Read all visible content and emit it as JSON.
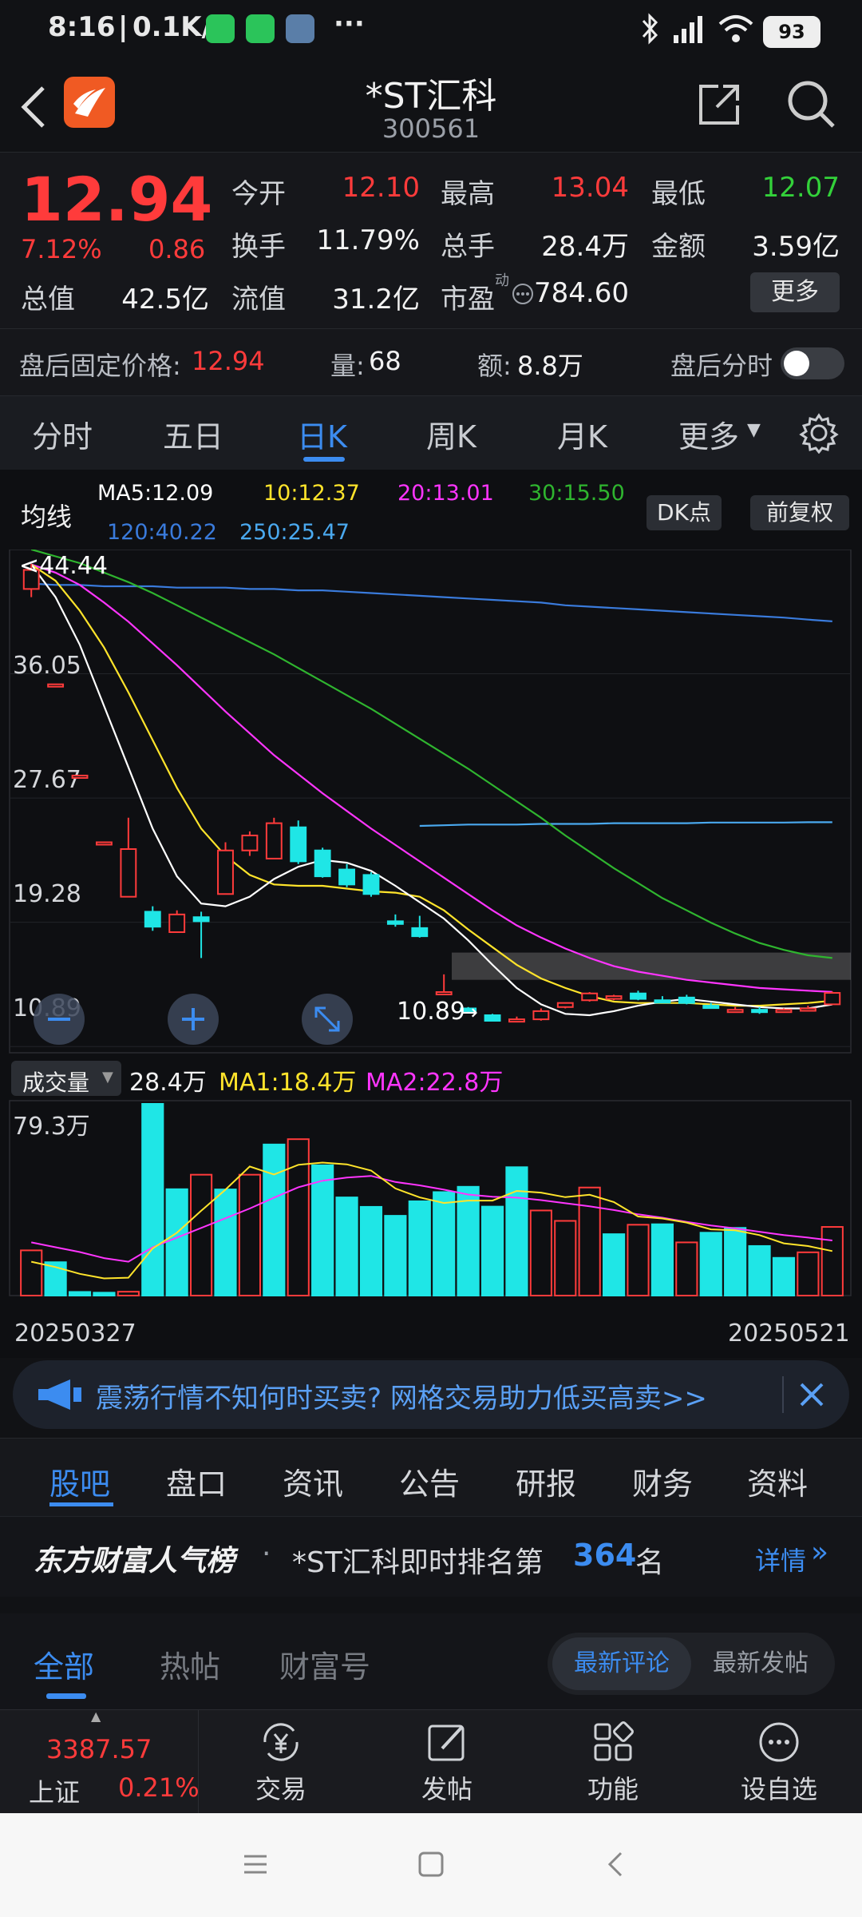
{
  "status_bar": {
    "time": "8:16",
    "net_speed": "0.1K/s",
    "battery": "93",
    "more": "···"
  },
  "header": {
    "title": "*ST汇科",
    "code": "300561"
  },
  "quote": {
    "price": "12.94",
    "change_pct": "7.12%",
    "change_amt": "0.86",
    "open_label": "今开",
    "open_val": "12.10",
    "high_label": "最高",
    "high_val": "13.04",
    "low_label": "最低",
    "low_val": "12.07",
    "turnover_label": "换手",
    "turnover_val": "11.79%",
    "volume_label": "总手",
    "volume_val": "28.4万",
    "amount_label": "金额",
    "amount_val": "3.59亿",
    "mktcap_label": "总值",
    "mktcap_val": "42.5亿",
    "float_label": "流值",
    "float_val": "31.2亿",
    "pe_label": "市盈",
    "pe_sup": "动",
    "pe_val": "784.60",
    "more_button": "更多",
    "after_label": "盘后固定价格:",
    "after_price": "12.94",
    "after_vol_label": "量:",
    "after_vol": "68",
    "after_amt_label": "额:",
    "after_amt": "8.8万",
    "after_toggle_label": "盘后分时"
  },
  "kline_tabs": [
    "分时",
    "五日",
    "日K",
    "周K",
    "月K",
    "更多"
  ],
  "kline_active": "日K",
  "ma_legend": {
    "title": "均线",
    "ma5": "MA5:12.09",
    "ma10": "10:12.37",
    "ma20": "20:13.01",
    "ma30": "30:15.50",
    "ma120": "120:40.22",
    "ma250": "250:25.47",
    "dk_button": "DK点",
    "adjust_button": "前复权"
  },
  "colors": {
    "up": "#ff3b3b",
    "down": "#1fe6e6",
    "ma5": "#ffffff",
    "ma10": "#ffe42b",
    "ma20": "#ff35ff",
    "ma30": "#2fb52f",
    "ma120": "#3a7bdc",
    "ma250": "#4aa9ef",
    "accent": "#3c8cf0"
  },
  "chart_data": [
    {
      "type": "candlestick",
      "y_ticks": [
        "36.05",
        "27.67",
        "19.28",
        "10.89"
      ],
      "max_label": "<44.44",
      "min_label": "10.89",
      "ylim": [
        10.89,
        44.44
      ],
      "candles": [
        {
          "o": 42.6,
          "c": 44.0,
          "h": 44.44,
          "l": 42.0
        },
        {
          "o": 35.6,
          "c": 35.6,
          "h": 35.6,
          "l": 35.6
        },
        {
          "o": 28.9,
          "c": 28.9,
          "h": 28.9,
          "l": 28.9
        },
        {
          "o": 24.0,
          "c": 24.0,
          "h": 24.0,
          "l": 24.0
        },
        {
          "o": 20.0,
          "c": 23.5,
          "h": 25.8,
          "l": 20.0
        },
        {
          "o": 18.9,
          "c": 17.8,
          "h": 19.3,
          "l": 17.5
        },
        {
          "o": 17.4,
          "c": 18.7,
          "h": 19.0,
          "l": 17.4
        },
        {
          "o": 18.5,
          "c": 18.2,
          "h": 18.9,
          "l": 15.5
        },
        {
          "o": 20.2,
          "c": 23.4,
          "h": 24.0,
          "l": 20.2
        },
        {
          "o": 23.4,
          "c": 24.5,
          "h": 24.8,
          "l": 23.0
        },
        {
          "o": 22.8,
          "c": 25.4,
          "h": 25.8,
          "l": 22.8
        },
        {
          "o": 25.1,
          "c": 22.6,
          "h": 25.6,
          "l": 22.4
        },
        {
          "o": 23.4,
          "c": 21.5,
          "h": 23.6,
          "l": 21.4
        },
        {
          "o": 22.0,
          "c": 20.9,
          "h": 22.4,
          "l": 20.7
        },
        {
          "o": 21.6,
          "c": 20.2,
          "h": 21.8,
          "l": 20.0
        },
        {
          "o": 18.2,
          "c": 18.0,
          "h": 18.7,
          "l": 17.8
        },
        {
          "o": 17.7,
          "c": 17.1,
          "h": 18.6,
          "l": 17.0
        },
        {
          "o": 13.0,
          "c": 13.0,
          "h": 14.3,
          "l": 13.0
        },
        {
          "o": 11.8,
          "c": 11.6,
          "h": 11.9,
          "l": 11.5
        },
        {
          "o": 11.3,
          "c": 10.89,
          "h": 11.4,
          "l": 10.89
        },
        {
          "o": 10.95,
          "c": 11.0,
          "h": 11.2,
          "l": 10.9
        },
        {
          "o": 11.0,
          "c": 11.6,
          "h": 11.8,
          "l": 10.9
        },
        {
          "o": 11.9,
          "c": 12.2,
          "h": 12.2,
          "l": 11.8
        },
        {
          "o": 12.4,
          "c": 12.9,
          "h": 13.0,
          "l": 12.3
        },
        {
          "o": 12.5,
          "c": 12.7,
          "h": 12.8,
          "l": 12.4
        },
        {
          "o": 12.9,
          "c": 12.5,
          "h": 13.1,
          "l": 12.4
        },
        {
          "o": 12.4,
          "c": 12.3,
          "h": 12.7,
          "l": 12.2
        },
        {
          "o": 12.6,
          "c": 12.2,
          "h": 12.8,
          "l": 12.1
        },
        {
          "o": 12.0,
          "c": 11.9,
          "h": 12.2,
          "l": 11.8
        },
        {
          "o": 11.6,
          "c": 11.7,
          "h": 11.9,
          "l": 11.5
        },
        {
          "o": 11.7,
          "c": 11.6,
          "h": 11.9,
          "l": 11.4
        },
        {
          "o": 11.6,
          "c": 11.7,
          "h": 11.8,
          "l": 11.5
        },
        {
          "o": 11.7,
          "c": 11.8,
          "h": 12.0,
          "l": 11.6
        },
        {
          "o": 12.1,
          "c": 12.94,
          "h": 13.04,
          "l": 12.07
        }
      ],
      "ma5": [
        44.4,
        42.0,
        38.5,
        34.0,
        29.5,
        25.0,
        21.5,
        19.5,
        19.3,
        20.0,
        21.3,
        22.2,
        22.7,
        22.5,
        21.9,
        20.8,
        19.6,
        18.4,
        16.8,
        15.0,
        13.3,
        12.1,
        11.4,
        11.3,
        11.6,
        12.0,
        12.3,
        12.5,
        12.3,
        12.1,
        11.9,
        11.8,
        11.8,
        12.09
      ],
      "ma10": [
        44.4,
        43.2,
        41.0,
        38.3,
        35.0,
        31.5,
        28.0,
        25.0,
        23.0,
        21.6,
        20.9,
        20.8,
        20.8,
        20.6,
        20.4,
        20.3,
        20.0,
        19.0,
        17.6,
        16.3,
        15.0,
        14.0,
        13.3,
        12.7,
        12.3,
        12.2,
        12.2,
        12.2,
        12.1,
        12.0,
        12.0,
        12.1,
        12.2,
        12.37
      ],
      "ma20": [
        44.4,
        43.8,
        42.9,
        41.6,
        40.2,
        38.6,
        37.0,
        35.3,
        33.6,
        32.0,
        30.4,
        29.0,
        27.6,
        26.3,
        25.0,
        23.8,
        22.6,
        21.4,
        20.2,
        19.0,
        17.9,
        17.0,
        16.2,
        15.5,
        14.9,
        14.5,
        14.2,
        13.9,
        13.7,
        13.5,
        13.3,
        13.2,
        13.1,
        13.01
      ],
      "ma30": [
        45.5,
        45.0,
        44.5,
        43.8,
        43.1,
        42.3,
        41.4,
        40.5,
        39.6,
        38.7,
        37.8,
        36.8,
        35.8,
        34.8,
        33.8,
        32.7,
        31.6,
        30.5,
        29.4,
        28.2,
        27.0,
        25.8,
        24.5,
        23.3,
        22.1,
        21.0,
        19.9,
        19.0,
        18.1,
        17.3,
        16.6,
        16.1,
        15.7,
        15.5
      ],
      "ma120": [
        43.0,
        42.9,
        42.9,
        42.8,
        42.8,
        42.8,
        42.7,
        42.7,
        42.7,
        42.6,
        42.6,
        42.5,
        42.5,
        42.4,
        42.3,
        42.2,
        42.1,
        42.0,
        41.9,
        41.8,
        41.7,
        41.6,
        41.4,
        41.3,
        41.2,
        41.1,
        41.0,
        40.9,
        40.8,
        40.7,
        40.6,
        40.5,
        40.35,
        40.22
      ],
      "ma250_segment": {
        "from_index": 16,
        "values": [
          25.2,
          25.25,
          25.3,
          25.3,
          25.3,
          25.35,
          25.35,
          25.35,
          25.4,
          25.4,
          25.4,
          25.4,
          25.45,
          25.45,
          25.45,
          25.45,
          25.47,
          25.47
        ]
      }
    },
    {
      "type": "bar",
      "legend_button": "成交量",
      "current": "28.4万",
      "ma1_label": "MA1:18.4万",
      "ma2_label": "MA2:22.8万",
      "max_label": "79.3万",
      "x_start": "20250327",
      "x_end": "20250521",
      "ylim": [
        0,
        79.3
      ],
      "volumes": [
        18.7,
        13.8,
        1.5,
        1.2,
        1.6,
        79.3,
        44.0,
        50.0,
        43.9,
        50.0,
        62.5,
        64.7,
        53.9,
        40.6,
        36.7,
        33.0,
        39.0,
        42.8,
        45.0,
        36.8,
        53.1,
        35.2,
        30.9,
        44.7,
        25.4,
        29.3,
        29.5,
        22.0,
        26.0,
        28.0,
        20.5,
        15.6,
        17.9,
        28.4
      ],
      "up_days": [
        0,
        4,
        7,
        9,
        11,
        21,
        22,
        23,
        25,
        27,
        32,
        33
      ],
      "ma1": [
        14.0,
        11.8,
        9.0,
        7.1,
        7.4,
        19.5,
        26.0,
        35.1,
        43.8,
        53.4,
        50.1,
        54.1,
        55.0,
        54.3,
        51.7,
        44.3,
        40.6,
        38.3,
        39.3,
        39.3,
        43.3,
        42.6,
        40.7,
        41.7,
        38.7,
        32.7,
        31.9,
        30.2,
        27.4,
        27.0,
        25.0,
        21.6,
        20.5,
        18.4
      ],
      "ma2": [
        22.0,
        20.0,
        18.0,
        15.5,
        14.0,
        20.0,
        24.0,
        28.0,
        32.0,
        36.0,
        40.5,
        44.8,
        47.5,
        48.8,
        49.5,
        47.0,
        45.6,
        43.8,
        41.8,
        40.9,
        40.5,
        39.5,
        38.2,
        36.9,
        35.4,
        33.6,
        32.2,
        30.5,
        29.0,
        27.8,
        26.4,
        25.0,
        24.0,
        22.8
      ]
    }
  ],
  "banner": {
    "text": "震荡行情不知何时买卖? 网格交易助力低买高卖>>"
  },
  "section_tabs": [
    "股吧",
    "盘口",
    "资讯",
    "公告",
    "研报",
    "财务",
    "资料"
  ],
  "section_active": "股吧",
  "ranking": {
    "brand": "东方财富人气榜",
    "prefix": "*ST汇科即时排名第",
    "rank": "364",
    "suffix": "名",
    "detail": "详情"
  },
  "filters": {
    "tabs": [
      "全部",
      "热帖",
      "财富号"
    ],
    "active": "全部",
    "toggle_a": "最新评论",
    "toggle_b": "最新发帖"
  },
  "bottom_nav": {
    "index_value": "3387.57",
    "index_name": "上证",
    "index_change": "0.21%",
    "items": [
      "交易",
      "发帖",
      "功能",
      "设自选"
    ]
  }
}
